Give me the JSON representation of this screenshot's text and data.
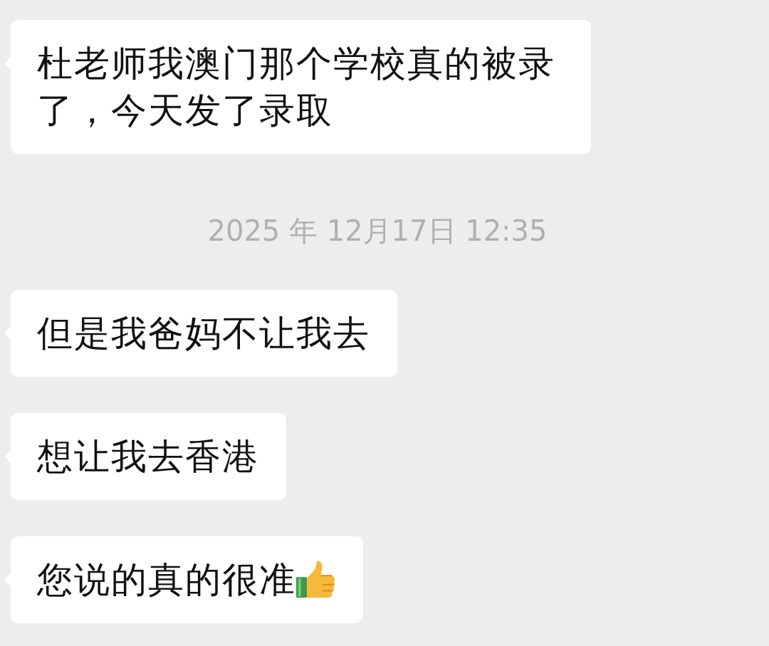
{
  "messages": [
    {
      "kind": "bubble",
      "text": "杜老师我澳门那个学校真的被录了，今天发了录取"
    },
    {
      "kind": "time",
      "text": "2025 年 12月17日 12:35"
    },
    {
      "kind": "bubble",
      "text": "但是我爸妈不让我去"
    },
    {
      "kind": "bubble",
      "text": "想让我去香港"
    },
    {
      "kind": "bubble_thumbs",
      "text": "您说的真的很准"
    }
  ]
}
